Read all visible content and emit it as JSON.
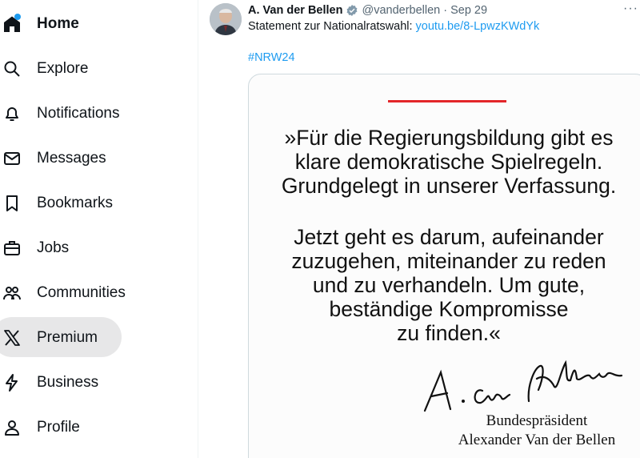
{
  "sidebar": {
    "items": [
      {
        "label": "Home",
        "icon": "home-icon"
      },
      {
        "label": "Explore",
        "icon": "search-icon"
      },
      {
        "label": "Notifications",
        "icon": "bell-icon"
      },
      {
        "label": "Messages",
        "icon": "envelope-icon"
      },
      {
        "label": "Bookmarks",
        "icon": "bookmark-icon"
      },
      {
        "label": "Jobs",
        "icon": "briefcase-icon"
      },
      {
        "label": "Communities",
        "icon": "communities-icon"
      },
      {
        "label": "Premium",
        "icon": "x-logo-icon"
      },
      {
        "label": "Business",
        "icon": "lightning-icon"
      },
      {
        "label": "Profile",
        "icon": "person-icon"
      }
    ]
  },
  "tweet": {
    "author": "A. Van der Bellen",
    "handle": "@vanderbellen",
    "separator": "·",
    "date": "Sep 29",
    "more": "···",
    "text": "Statement zur Nationalratswahl: ",
    "link": "youtu.be/8-LpwzKWdYk",
    "hashtag": "#NRW24",
    "image": {
      "quote_lines_1": [
        "»Für die Regierungsbildung gibt es",
        "klare  demokratische Spielregeln.",
        "Grundgelegt in unserer Verfassung."
      ],
      "quote_lines_2": [
        "Jetzt geht es darum, aufeinander",
        "zuzugehen, miteinander zu reden",
        "und zu verhandeln. Um gute,",
        "beständige Kompromisse",
        "zu finden.«"
      ],
      "signature_title": "Bundespräsident",
      "signature_name": "Alexander Van der Bellen"
    }
  },
  "colors": {
    "accent": "#1d9bf0",
    "text": "#0f1419",
    "muted": "#536471",
    "rule": "#e3262a"
  }
}
